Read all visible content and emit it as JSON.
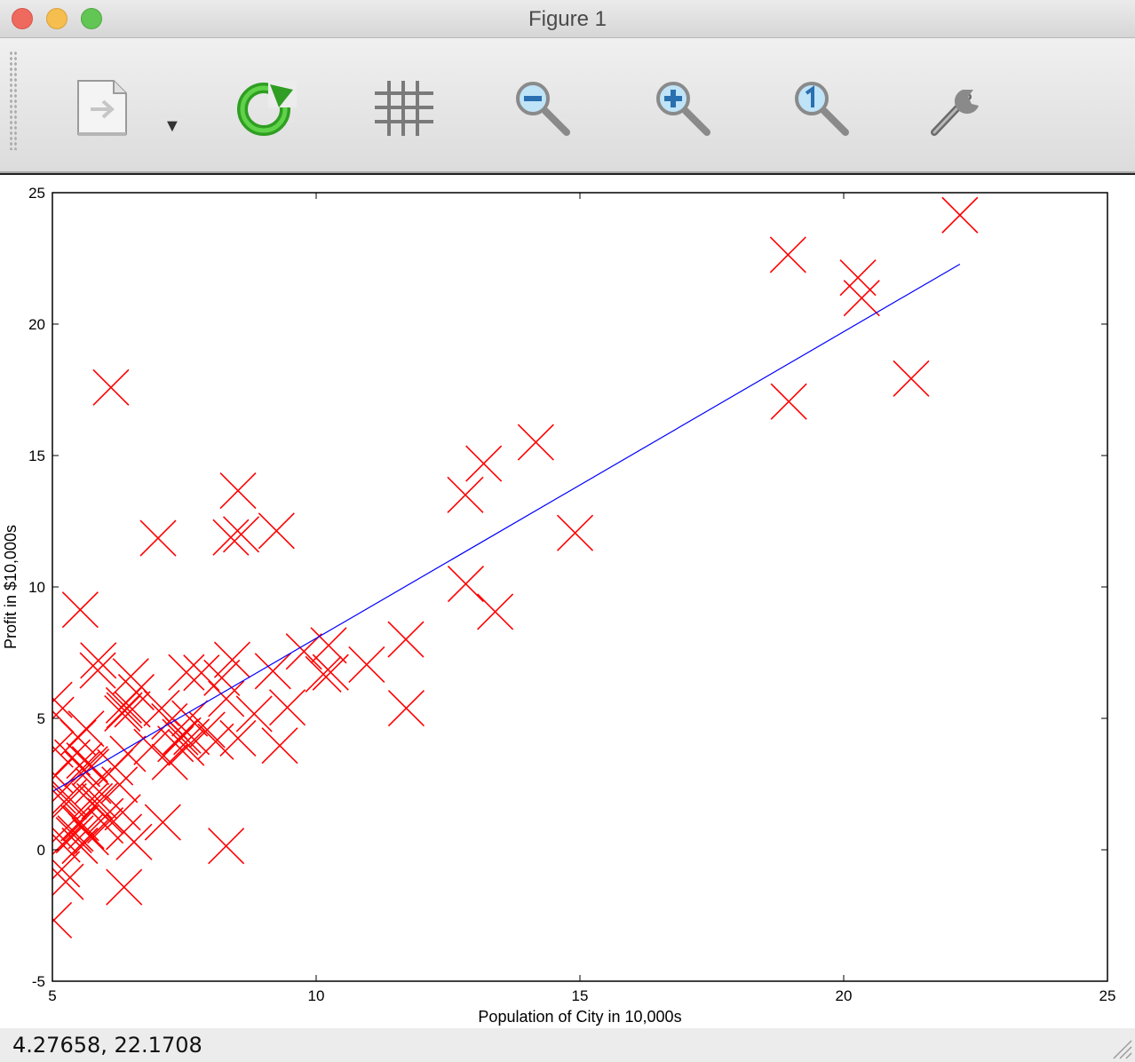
{
  "window": {
    "title": "Figure 1"
  },
  "toolbar": {
    "items": [
      {
        "name": "export-icon",
        "has_dropdown": true
      },
      {
        "name": "refresh-icon"
      },
      {
        "name": "grid-icon"
      },
      {
        "name": "zoom-out-icon"
      },
      {
        "name": "zoom-in-icon"
      },
      {
        "name": "zoom-reset-icon"
      },
      {
        "name": "wrench-icon"
      }
    ],
    "dropdown_glyph": "▼"
  },
  "status": {
    "coordinates": "4.27658,  22.1708"
  },
  "chart_data": {
    "type": "scatter",
    "xlabel": "Population of City in 10,000s",
    "ylabel": "Profit in $10,000s",
    "xlim": [
      5,
      25
    ],
    "ylim": [
      -5,
      25
    ],
    "xticks": [
      5,
      10,
      15,
      20,
      25
    ],
    "yticks": [
      -5,
      0,
      5,
      10,
      15,
      20,
      25
    ],
    "grid": false,
    "series": [
      {
        "kind": "scatter",
        "marker": "x",
        "color": "#ff0000",
        "points": [
          [
            6.1101,
            17.592
          ],
          [
            5.5277,
            9.1302
          ],
          [
            8.5186,
            13.662
          ],
          [
            7.0032,
            11.854
          ],
          [
            5.8598,
            6.8233
          ],
          [
            8.3829,
            11.886
          ],
          [
            7.4764,
            4.3483
          ],
          [
            8.5781,
            12.0
          ],
          [
            6.4862,
            6.5987
          ],
          [
            5.0546,
            3.8166
          ],
          [
            5.7107,
            3.2522
          ],
          [
            14.164,
            15.505
          ],
          [
            5.734,
            3.1551
          ],
          [
            8.4084,
            7.2258
          ],
          [
            5.6407,
            0.71618
          ],
          [
            5.3794,
            3.5129
          ],
          [
            6.3654,
            5.3048
          ],
          [
            5.1301,
            0.56077
          ],
          [
            6.4296,
            3.6518
          ],
          [
            7.0708,
            5.3893
          ],
          [
            6.1891,
            3.1386
          ],
          [
            20.27,
            21.767
          ],
          [
            5.4901,
            4.263
          ],
          [
            6.3261,
            5.1875
          ],
          [
            5.5649,
            3.0825
          ],
          [
            18.945,
            22.638
          ],
          [
            12.828,
            13.501
          ],
          [
            10.957,
            7.0467
          ],
          [
            13.176,
            14.692
          ],
          [
            22.203,
            24.147
          ],
          [
            5.2524,
            -1.22
          ],
          [
            6.5894,
            5.9966
          ],
          [
            9.2482,
            12.134
          ],
          [
            5.8918,
            1.8495
          ],
          [
            8.2111,
            6.5426
          ],
          [
            7.9334,
            4.5623
          ],
          [
            8.0959,
            4.1164
          ],
          [
            5.6063,
            3.3928
          ],
          [
            12.836,
            10.117
          ],
          [
            6.3534,
            5.4974
          ],
          [
            5.4069,
            0.55657
          ],
          [
            6.8825,
            3.9115
          ],
          [
            11.708,
            5.3854
          ],
          [
            5.7737,
            2.4406
          ],
          [
            7.8247,
            6.7318
          ],
          [
            7.0931,
            1.0463
          ],
          [
            5.0702,
            5.1337
          ],
          [
            5.8014,
            1.844
          ],
          [
            11.7,
            8.0043
          ],
          [
            5.5416,
            1.0179
          ],
          [
            7.5402,
            6.7504
          ],
          [
            5.3077,
            1.8396
          ],
          [
            7.4239,
            4.2885
          ],
          [
            7.6031,
            4.9981
          ],
          [
            6.3328,
            1.4233
          ],
          [
            6.3589,
            -1.4211
          ],
          [
            6.2742,
            2.4756
          ],
          [
            5.6397,
            4.6042
          ],
          [
            9.3102,
            3.9624
          ],
          [
            9.4536,
            5.4141
          ],
          [
            8.8254,
            5.1694
          ],
          [
            5.1793,
            -0.74279
          ],
          [
            21.279,
            17.929
          ],
          [
            14.908,
            12.054
          ],
          [
            18.959,
            17.054
          ],
          [
            7.2182,
            4.8852
          ],
          [
            8.2951,
            5.7442
          ],
          [
            10.236,
            7.7754
          ],
          [
            5.4994,
            1.0173
          ],
          [
            20.341,
            20.992
          ],
          [
            10.136,
            6.6799
          ],
          [
            7.3345,
            4.0259
          ],
          [
            6.0062,
            1.2784
          ],
          [
            7.2259,
            3.3411
          ],
          [
            5.0269,
            -2.6807
          ],
          [
            6.5479,
            0.29678
          ],
          [
            7.5386,
            3.8845
          ],
          [
            5.0365,
            5.7014
          ],
          [
            10.274,
            6.7526
          ],
          [
            5.1077,
            2.0576
          ],
          [
            5.7292,
            0.47953
          ],
          [
            5.1884,
            0.20421
          ],
          [
            6.3557,
            0.67861
          ],
          [
            9.7687,
            7.5435
          ],
          [
            6.5159,
            5.3436
          ],
          [
            8.5172,
            4.2415
          ],
          [
            9.1802,
            6.7981
          ],
          [
            6.002,
            0.92695
          ],
          [
            5.5204,
            0.152
          ],
          [
            5.0594,
            2.8214
          ],
          [
            5.7077,
            1.8451
          ],
          [
            7.6366,
            4.2959
          ],
          [
            5.8707,
            7.2029
          ],
          [
            5.3054,
            1.9869
          ],
          [
            8.2934,
            0.14454
          ],
          [
            13.394,
            9.0551
          ],
          [
            5.4369,
            0.61705
          ]
        ]
      },
      {
        "kind": "line",
        "color": "#0000ff",
        "points": [
          [
            5.0269,
            2.2442
          ],
          [
            22.203,
            22.2805
          ]
        ]
      }
    ]
  }
}
